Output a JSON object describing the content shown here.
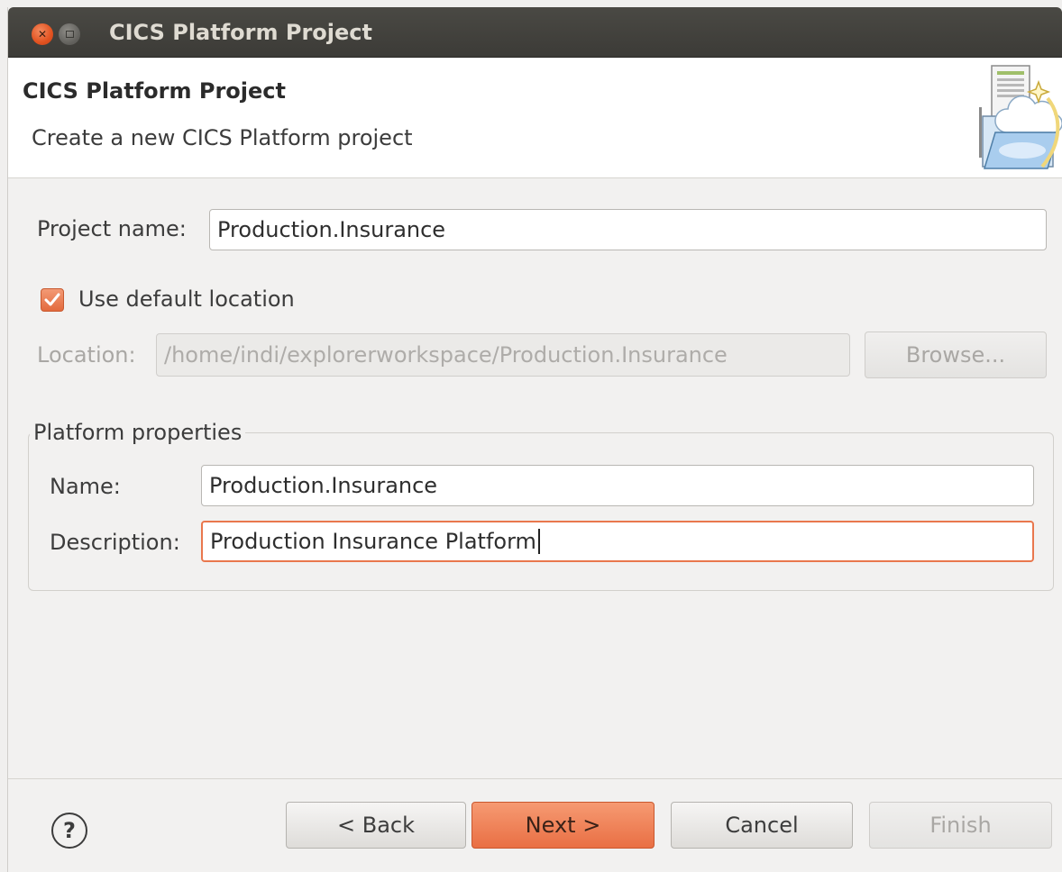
{
  "window": {
    "title": "CICS Platform Project"
  },
  "banner": {
    "title": "CICS Platform Project",
    "subtitle": "Create a new CICS Platform project",
    "icon": "new-project-wizard-icon"
  },
  "form": {
    "project_name_label": "Project name:",
    "project_name_value": "Production.Insurance",
    "use_default_label": "Use default location",
    "use_default_checked": true,
    "location_label": "Location:",
    "location_value": "/home/indi/explorerworkspace/Production.Insurance",
    "browse_label": "Browse..."
  },
  "platform_properties": {
    "group_label": "Platform properties",
    "name_label": "Name:",
    "name_value": "Production.Insurance",
    "description_label": "Description:",
    "description_value": "Production Insurance Platform"
  },
  "footer": {
    "help_icon": "help-icon",
    "back_label": "< Back",
    "next_label": "Next >",
    "cancel_label": "Cancel",
    "finish_label": "Finish"
  },
  "colors": {
    "accent": "#e96f44",
    "titlebar": "#3c3b37"
  }
}
